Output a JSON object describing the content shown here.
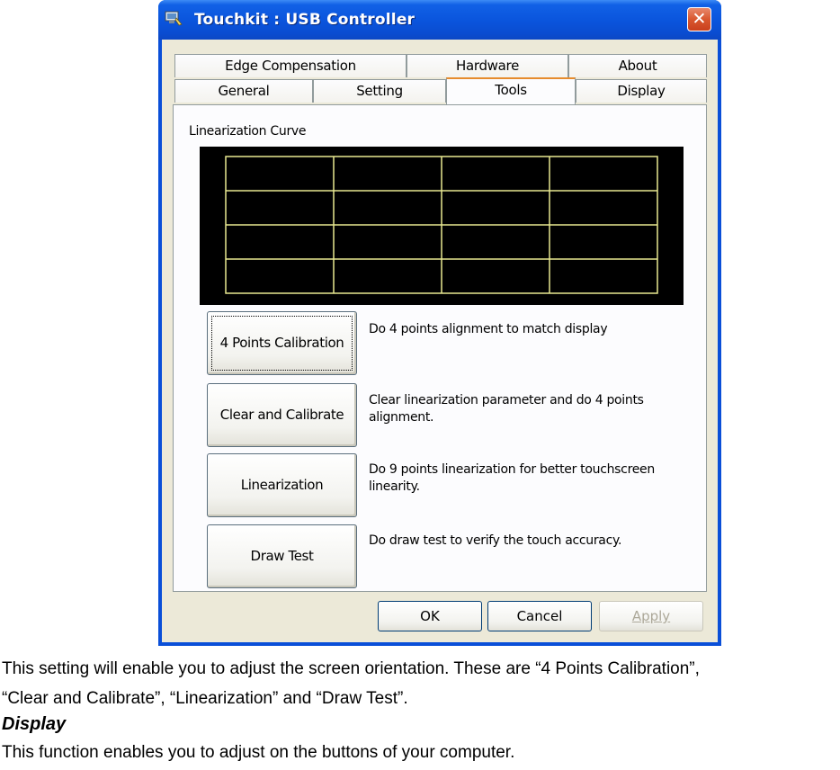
{
  "window": {
    "title": "Touchkit : USB Controller",
    "close_glyph": "✕"
  },
  "tabs": {
    "back_row": [
      "Edge Compensation",
      "Hardware",
      "About"
    ],
    "front_row": [
      "General",
      "Setting",
      "Tools",
      "Display"
    ],
    "active": "Tools"
  },
  "linearization": {
    "label": "Linearization Curve",
    "grid_rows": 4,
    "grid_cols": 4,
    "grid_color": "#e8e890",
    "background": "#000000"
  },
  "tools": [
    {
      "button": "4 Points Calibration",
      "description": "Do 4 points alignment to match display",
      "focused": true
    },
    {
      "button": "Clear and Calibrate",
      "description": "Clear linearization parameter and do 4 points alignment.",
      "focused": false
    },
    {
      "button": "Linearization",
      "description": "Do 9 points linearization for better touchscreen linearity.",
      "focused": false
    },
    {
      "button": "Draw Test",
      "description": "Do draw test to verify the touch accuracy.",
      "focused": false
    }
  ],
  "dialog_buttons": {
    "ok": "OK",
    "cancel": "Cancel",
    "apply": "Apply",
    "apply_disabled": true
  },
  "document": {
    "line1": "This setting will enable you to adjust the screen orientation. These are “4 Points Calibration”,",
    "line2": "“Clear and Calibrate”, “Linearization” and “Draw Test”.",
    "heading": "Display",
    "line3": "This function enables you to adjust on the buttons of your computer."
  },
  "colors": {
    "titlebar": "#0a54dc",
    "dialog_face": "#ece9d8",
    "active_tab_accent": "#e68b2c"
  }
}
